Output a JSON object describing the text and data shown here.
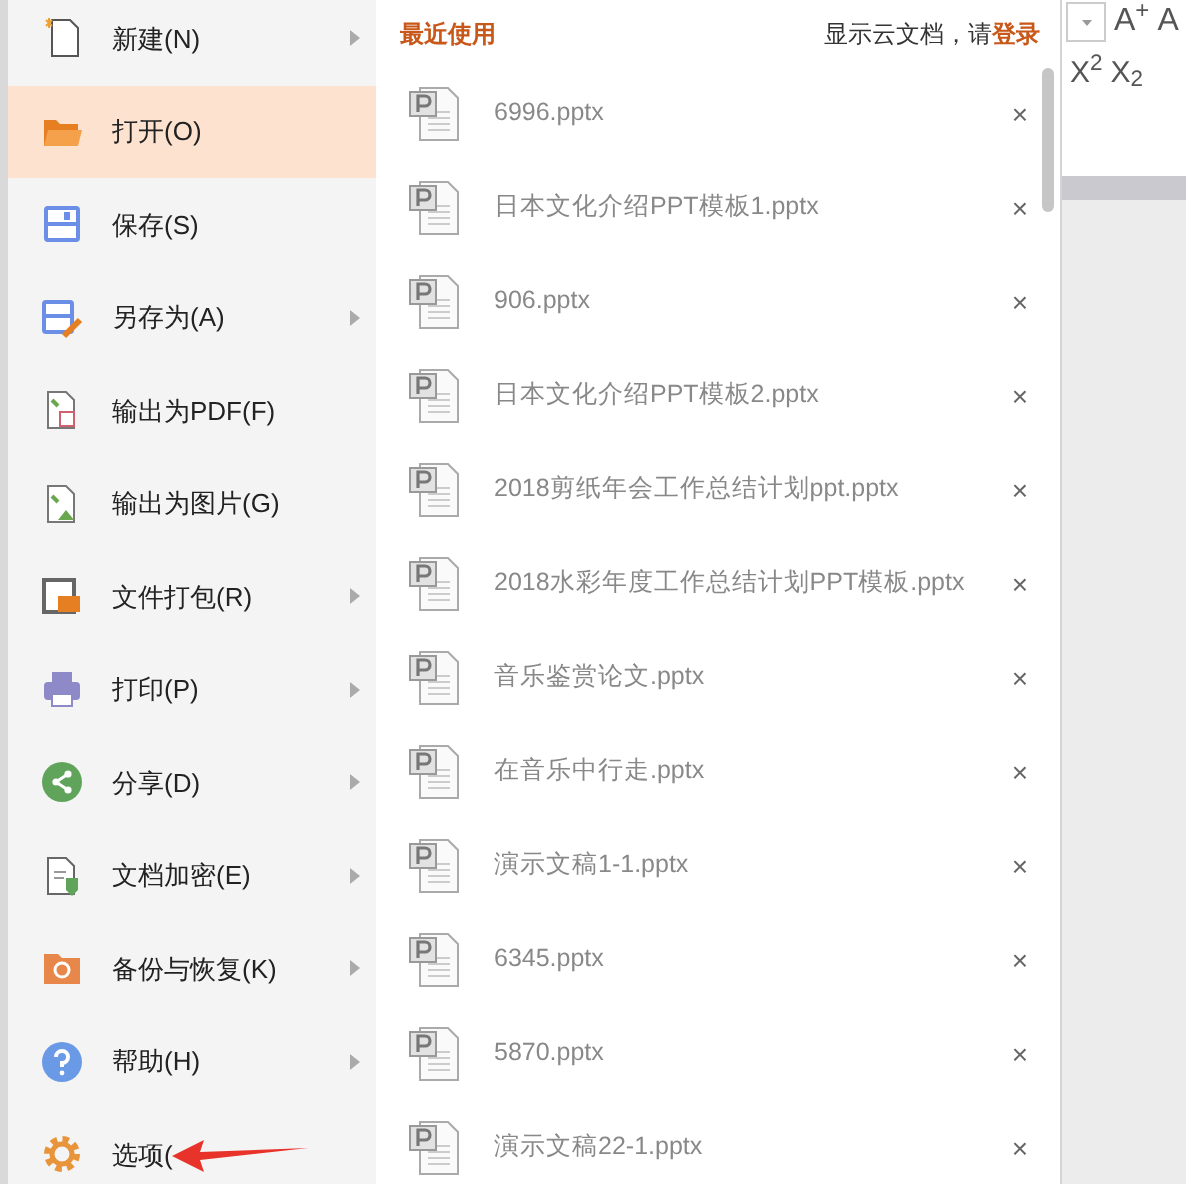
{
  "menu": [
    {
      "label": "新建(N)",
      "selected": false,
      "has_submenu": true
    },
    {
      "label": "打开(O)",
      "selected": true,
      "has_submenu": false
    },
    {
      "label": "保存(S)",
      "selected": false,
      "has_submenu": false
    },
    {
      "label": "另存为(A)",
      "selected": false,
      "has_submenu": true
    },
    {
      "label": "输出为PDF(F)",
      "selected": false,
      "has_submenu": false
    },
    {
      "label": "输出为图片(G)",
      "selected": false,
      "has_submenu": false
    },
    {
      "label": "文件打包(R)",
      "selected": false,
      "has_submenu": true
    },
    {
      "label": "打印(P)",
      "selected": false,
      "has_submenu": true
    },
    {
      "label": "分享(D)",
      "selected": false,
      "has_submenu": true
    },
    {
      "label": "文档加密(E)",
      "selected": false,
      "has_submenu": true
    },
    {
      "label": "备份与恢复(K)",
      "selected": false,
      "has_submenu": true
    },
    {
      "label": "帮助(H)",
      "selected": false,
      "has_submenu": true
    },
    {
      "label": "选项(",
      "selected": false,
      "has_submenu": false
    }
  ],
  "recent": {
    "title": "最近使用",
    "cloud_hint": "显示云文档，请",
    "login_link": "登录",
    "files": [
      {
        "name": "6996.pptx",
        "close": "×"
      },
      {
        "name": "日本文化介绍PPT模板1.pptx",
        "close": "×"
      },
      {
        "name": "906.pptx",
        "close": "×"
      },
      {
        "name": "日本文化介绍PPT模板2.pptx",
        "close": "×"
      },
      {
        "name": "2018剪纸年会工作总结计划ppt.pptx",
        "close": "×"
      },
      {
        "name": "2018水彩年度工作总结计划PPT模板.pptx",
        "close": "×"
      },
      {
        "name": "音乐鉴赏论文.pptx",
        "close": "×"
      },
      {
        "name": "在音乐中行走.pptx",
        "close": "×"
      },
      {
        "name": "演示文稿1-1.pptx",
        "close": "×"
      },
      {
        "name": "6345.pptx",
        "close": "×"
      },
      {
        "name": "5870.pptx",
        "close": "×"
      },
      {
        "name": "演示文稿22-1.pptx",
        "close": "×"
      }
    ]
  },
  "ribbon": {
    "row_1": [
      "A$^{+}$",
      "A"
    ],
    "row_2": [
      "X$^{2}$",
      "X$_{2}$"
    ]
  }
}
